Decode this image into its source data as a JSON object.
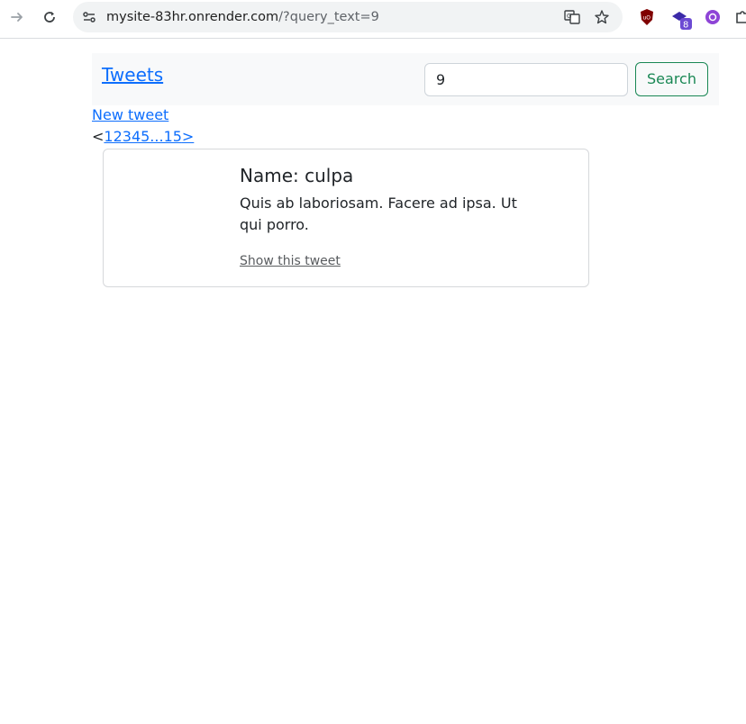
{
  "browser": {
    "url_host": "mysite-83hr.onrender.com",
    "url_path": "/?query_text=9",
    "extension_badge": "8",
    "ublock_label": "uO"
  },
  "navbar": {
    "brand": "Tweets",
    "search_value": "9",
    "search_button": "Search"
  },
  "new_tweet_link": "New tweet",
  "pagination": {
    "prev": "<",
    "pages_label": "12345...15",
    "next": ">"
  },
  "tweets": [
    {
      "name": "Name: culpa",
      "body": "Quis ab laboriosam. Facere ad ipsa. Ut qui porro.",
      "show_link": "Show this tweet"
    }
  ],
  "colors": {
    "link": "#0d6efd",
    "success": "#198754",
    "navbar_bg": "#f8f9fa"
  }
}
